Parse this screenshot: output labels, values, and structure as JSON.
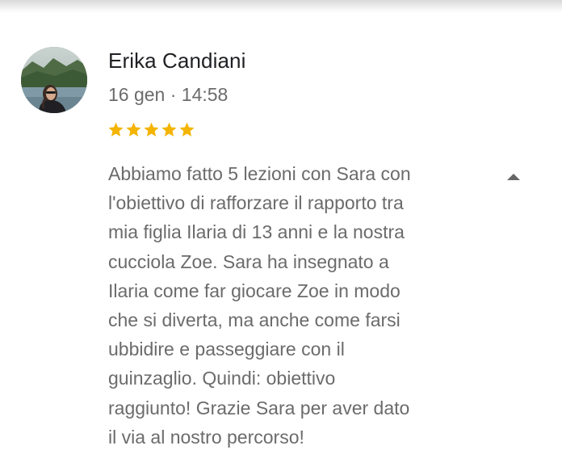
{
  "review": {
    "author_name": "Erika Candiani",
    "timestamp": "16 gen · 14:58",
    "rating": 5,
    "rating_max": 5,
    "star_color": "#f4b400",
    "text_lines": [
      "Abbiamo fatto 5 lezioni con Sara con",
      "l'obiettivo di rafforzare il rapporto tra",
      "mia figlia Ilaria di 13 anni e la nostra",
      "cucciola Zoe. Sara ha insegnato a",
      "Ilaria come far giocare Zoe in modo",
      "che si diverta, ma anche come farsi",
      "ubbidire e passeggiare con il",
      "guinzaglio. Quindi: obiettivo",
      "raggiunto! Grazie Sara per aver dato",
      "il via al nostro percorso!"
    ],
    "collapse_icon": "triangle-up-icon",
    "avatar_icon": "user-photo-avatar"
  }
}
